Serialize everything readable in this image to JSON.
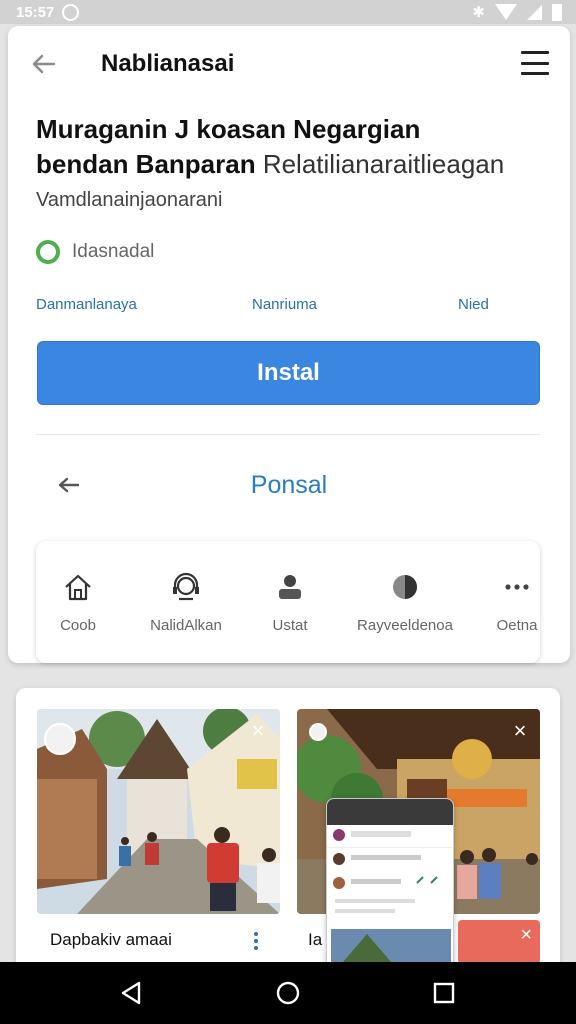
{
  "status_bar": {
    "time": "15:57"
  },
  "app_bar": {
    "title": "Nablianasai"
  },
  "app_info": {
    "title_line1": "Muraganin J koasan Negargian",
    "title_line2_bold": "bendan Banparan",
    "title_line2_rest": " Relatilianaraitlieagan",
    "developer": "Vamdlanainjaonarani",
    "status": "Idasnadal"
  },
  "meta_links": [
    "Danmanlanaya",
    "Nanriuma",
    "Nied"
  ],
  "install_button": {
    "label": "Instal"
  },
  "secondary_action": {
    "label": "Ponsal"
  },
  "categories": [
    {
      "label": "Coob",
      "icon": "home-icon"
    },
    {
      "label": "NalidAlkan",
      "icon": "headset-icon"
    },
    {
      "label": "Ustat",
      "icon": "person-icon"
    },
    {
      "label": "Rayveeldenoa",
      "icon": "half-circle-icon"
    },
    {
      "label": "Oetna",
      "icon": "more-horizontal-icon"
    }
  ],
  "gallery": {
    "item1_title": "Dapbakiv amaai",
    "item2_title_partial": "Ia"
  },
  "colors": {
    "accent": "#3b86e0",
    "link": "#2a6fb0",
    "status": "#4caf50"
  }
}
